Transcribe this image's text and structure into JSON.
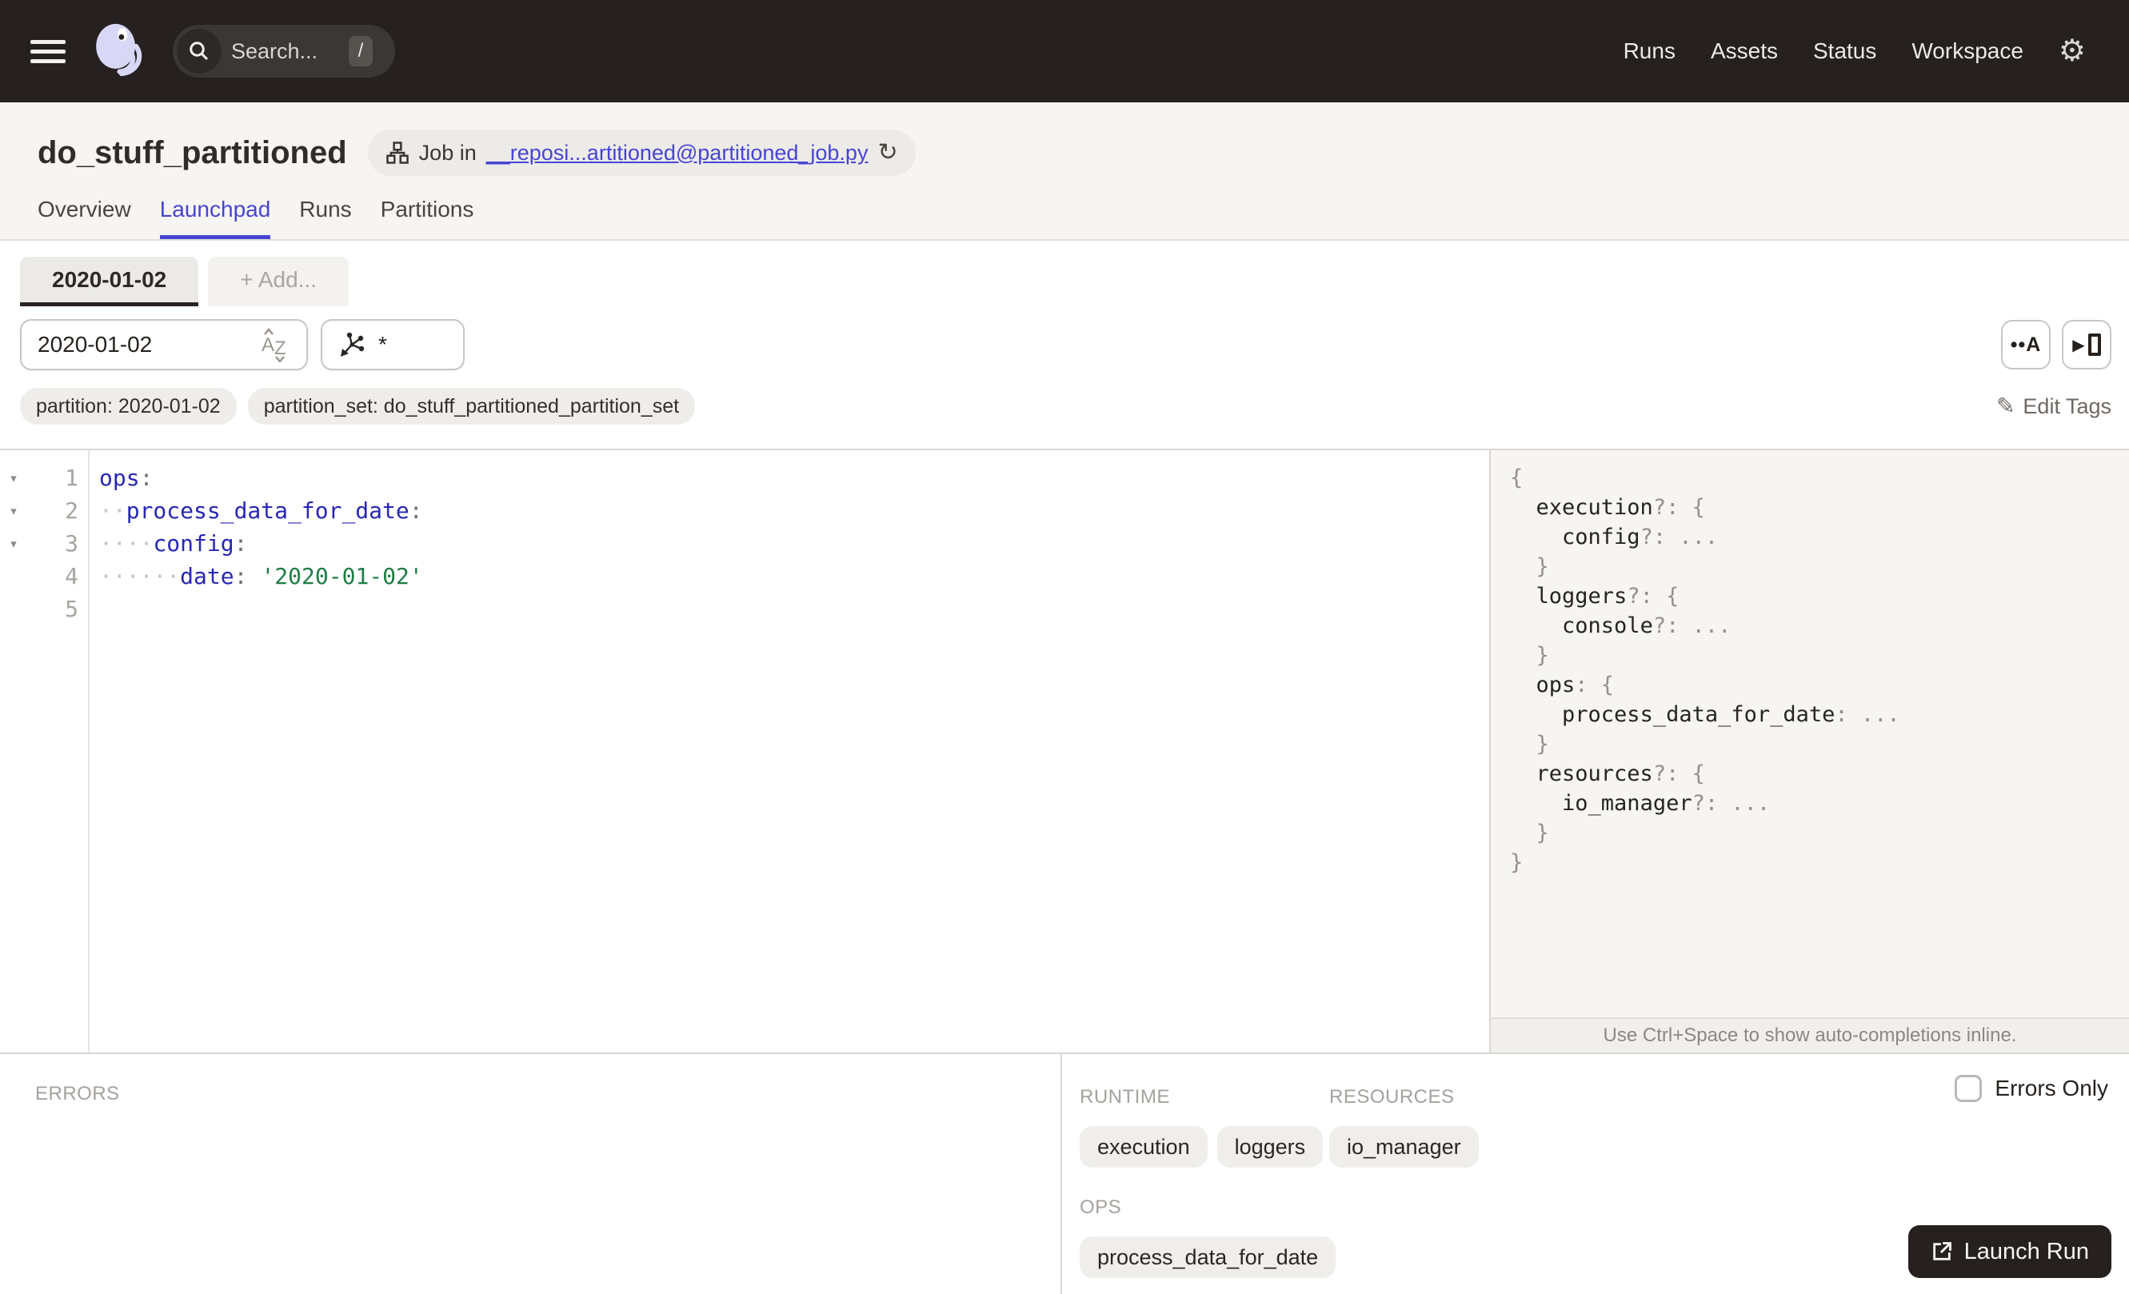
{
  "nav": {
    "search": {
      "placeholder": "Search...",
      "shortcut": "/"
    },
    "links": [
      {
        "label": "Runs"
      },
      {
        "label": "Assets"
      },
      {
        "label": "Status"
      },
      {
        "label": "Workspace"
      }
    ]
  },
  "header": {
    "title": "do_stuff_partitioned",
    "badge": {
      "prefix": "Job in",
      "link": "__reposi...artitioned@partitioned_job.py"
    }
  },
  "tabs": [
    {
      "label": "Overview"
    },
    {
      "label": "Launchpad"
    },
    {
      "label": "Runs"
    },
    {
      "label": "Partitions"
    }
  ],
  "launchpad": {
    "config_tabs": [
      {
        "label": "2020-01-02"
      },
      {
        "label": "+ Add..."
      }
    ],
    "partition_select": {
      "value": "2020-01-02"
    },
    "op_select": {
      "value": "*"
    },
    "toolbar": {
      "autocomplete_label": "••A"
    },
    "tags": [
      {
        "label": "partition: 2020-01-02"
      },
      {
        "label": "partition_set: do_stuff_partitioned_partition_set"
      }
    ],
    "edit_tags_label": "Edit Tags",
    "editor": {
      "lines": [
        {
          "num": "1",
          "fold": "▾",
          "dots": "",
          "key": "ops",
          "colon": ":",
          "value": ""
        },
        {
          "num": "2",
          "fold": "▾",
          "dots": "··",
          "key": "process_data_for_date",
          "colon": ":",
          "value": ""
        },
        {
          "num": "3",
          "fold": "▾",
          "dots": "····",
          "key": "config",
          "colon": ":",
          "value": ""
        },
        {
          "num": "4",
          "fold": "",
          "dots": "······",
          "key": "date",
          "colon": ":",
          "value": "'2020-01-02'"
        },
        {
          "num": "5",
          "fold": "",
          "dots": "",
          "key": "",
          "colon": "",
          "value": ""
        }
      ]
    },
    "schema": {
      "lines": [
        {
          "pre": "",
          "name": "",
          "punct": "{"
        },
        {
          "pre": "  ",
          "name": "execution",
          "punct": "?: {"
        },
        {
          "pre": "    ",
          "name": "config",
          "punct": "?: ..."
        },
        {
          "pre": "  ",
          "name": "",
          "punct": "}"
        },
        {
          "pre": "  ",
          "name": "loggers",
          "punct": "?: {"
        },
        {
          "pre": "    ",
          "name": "console",
          "punct": "?: ..."
        },
        {
          "pre": "  ",
          "name": "",
          "punct": "}"
        },
        {
          "pre": "  ",
          "name": "ops",
          "punct": ": {"
        },
        {
          "pre": "    ",
          "name": "process_data_for_date",
          "punct": ": ..."
        },
        {
          "pre": "  ",
          "name": "",
          "punct": "}"
        },
        {
          "pre": "  ",
          "name": "resources",
          "punct": "?: {"
        },
        {
          "pre": "    ",
          "name": "io_manager",
          "punct": "?: ..."
        },
        {
          "pre": "  ",
          "name": "",
          "punct": "}"
        },
        {
          "pre": "",
          "name": "",
          "punct": "}"
        }
      ],
      "hint": "Use Ctrl+Space to show auto-completions inline."
    }
  },
  "bottom": {
    "errors_label": "ERRORS",
    "runtime": {
      "label": "RUNTIME",
      "tags": [
        "execution",
        "loggers"
      ]
    },
    "resources": {
      "label": "RESOURCES",
      "tags": [
        "io_manager"
      ]
    },
    "ops": {
      "label": "OPS",
      "tags": [
        "process_data_for_date"
      ]
    },
    "errors_only_label": "Errors Only",
    "launch_label": "Launch Run"
  },
  "icons": {
    "gear": "⚙",
    "refresh": "↻",
    "pencil": "✎",
    "play": "▶"
  },
  "colors": {
    "accent": "#4645d2",
    "nav_bg": "#262120",
    "code_key": "#2727b5",
    "code_string": "#1d7d45",
    "logo_lavender": "#d9d7f6"
  }
}
